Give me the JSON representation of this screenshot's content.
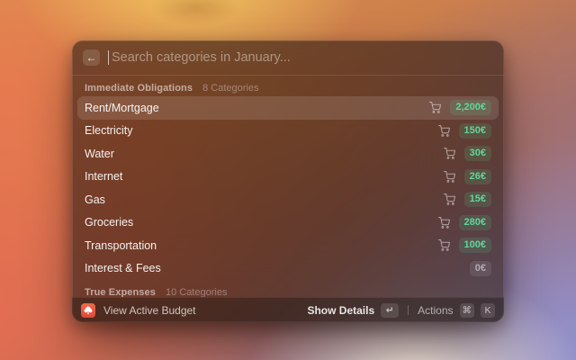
{
  "window": {
    "search": {
      "placeholder": "Search categories in January...",
      "value": "",
      "back_icon": "←"
    },
    "sections": [
      {
        "title": "Immediate Obligations",
        "subtitle": "8 Categories",
        "items": [
          {
            "label": "Rent/Mortgage",
            "amount": "2,200€",
            "selected": true,
            "cart": true,
            "tone": "green"
          },
          {
            "label": "Electricity",
            "amount": "150€",
            "selected": false,
            "cart": true,
            "tone": "green"
          },
          {
            "label": "Water",
            "amount": "30€",
            "selected": false,
            "cart": true,
            "tone": "green"
          },
          {
            "label": "Internet",
            "amount": "26€",
            "selected": false,
            "cart": true,
            "tone": "green"
          },
          {
            "label": "Gas",
            "amount": "15€",
            "selected": false,
            "cart": true,
            "tone": "green"
          },
          {
            "label": "Groceries",
            "amount": "280€",
            "selected": false,
            "cart": true,
            "tone": "green"
          },
          {
            "label": "Transportation",
            "amount": "100€",
            "selected": false,
            "cart": true,
            "tone": "green"
          },
          {
            "label": "Interest & Fees",
            "amount": "0€",
            "selected": false,
            "cart": false,
            "tone": "muted"
          }
        ]
      },
      {
        "title": "True Expenses",
        "subtitle": "10 Categories",
        "items": []
      }
    ],
    "footer": {
      "app_label": "View Active Budget",
      "primary_action": "Show Details",
      "primary_key": "↵",
      "secondary_action": "Actions",
      "secondary_keys": [
        "⌘",
        "K"
      ]
    }
  },
  "colors": {
    "amount_green": "#5fd79a",
    "app_icon_red": "#dd4b38",
    "window_tint": "rgba(44,31,26,0.62)"
  }
}
